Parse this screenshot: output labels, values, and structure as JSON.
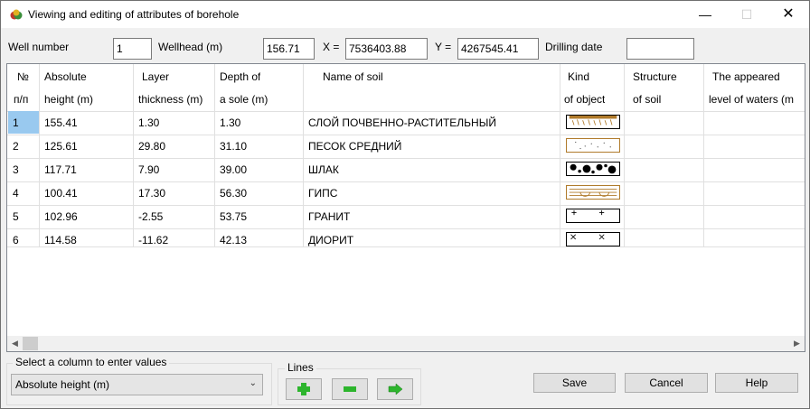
{
  "window": {
    "title": "Viewing and editing of attributes of borehole"
  },
  "header": {
    "well_number_label": "Well number",
    "well_number_value": "1",
    "wellhead_label": "Wellhead (m)",
    "wellhead_value": "156.71",
    "x_label": "X =",
    "x_value": "7536403.88",
    "y_label": "Y =",
    "y_value": "4267545.41",
    "drilling_date_label": "Drilling date",
    "drilling_date_value": ""
  },
  "grid": {
    "columns": [
      {
        "line1": "№",
        "line2": "п/п"
      },
      {
        "line1": "Absolute",
        "line2": " height (m)"
      },
      {
        "line1": "Layer",
        "line2": "thickness (m)"
      },
      {
        "line1": "Depth of",
        "line2": " a sole (m)"
      },
      {
        "line1": "Name of soil",
        "line2": ""
      },
      {
        "line1": "Kind",
        "line2": "of object"
      },
      {
        "line1": "Structure",
        "line2": "of soil"
      },
      {
        "line1": "The appeared",
        "line2": "level of waters (m"
      }
    ],
    "rows": [
      {
        "n": "1",
        "height": "155.41",
        "thickness": "1.30",
        "depth": "1.30",
        "soil": "СЛОЙ ПОЧВЕННО-РАСТИТЕЛЬНЫЙ",
        "pattern": "topsoil-pattern"
      },
      {
        "n": "2",
        "height": "125.61",
        "thickness": "29.80",
        "depth": "31.10",
        "soil": "ПЕСОК СРЕДНИЙ",
        "pattern": "sand-pattern"
      },
      {
        "n": "3",
        "height": "117.71",
        "thickness": "7.90",
        "depth": "39.00",
        "soil": "ШЛАК",
        "pattern": "slag-pattern"
      },
      {
        "n": "4",
        "height": "100.41",
        "thickness": "17.30",
        "depth": "56.30",
        "soil": "ГИПС",
        "pattern": "gypsum-pattern"
      },
      {
        "n": "5",
        "height": "102.96",
        "thickness": "-2.55",
        "depth": "53.75",
        "soil": "ГРАНИТ",
        "pattern": "granite-pattern"
      },
      {
        "n": "6",
        "height": "114.58",
        "thickness": "-11.62",
        "depth": "42.13",
        "soil": "ДИОРИТ",
        "pattern": "diorite-pattern"
      }
    ]
  },
  "footer": {
    "select_group_label": "Select a column to enter values",
    "select_value": "Absolute height (m)",
    "lines_group_label": "Lines",
    "save_label": "Save",
    "cancel_label": "Cancel",
    "help_label": "Help"
  },
  "colors": {
    "selection": "#99c9ef",
    "add_icon": "#2db52d",
    "pattern_brown": "#b07b2c"
  }
}
